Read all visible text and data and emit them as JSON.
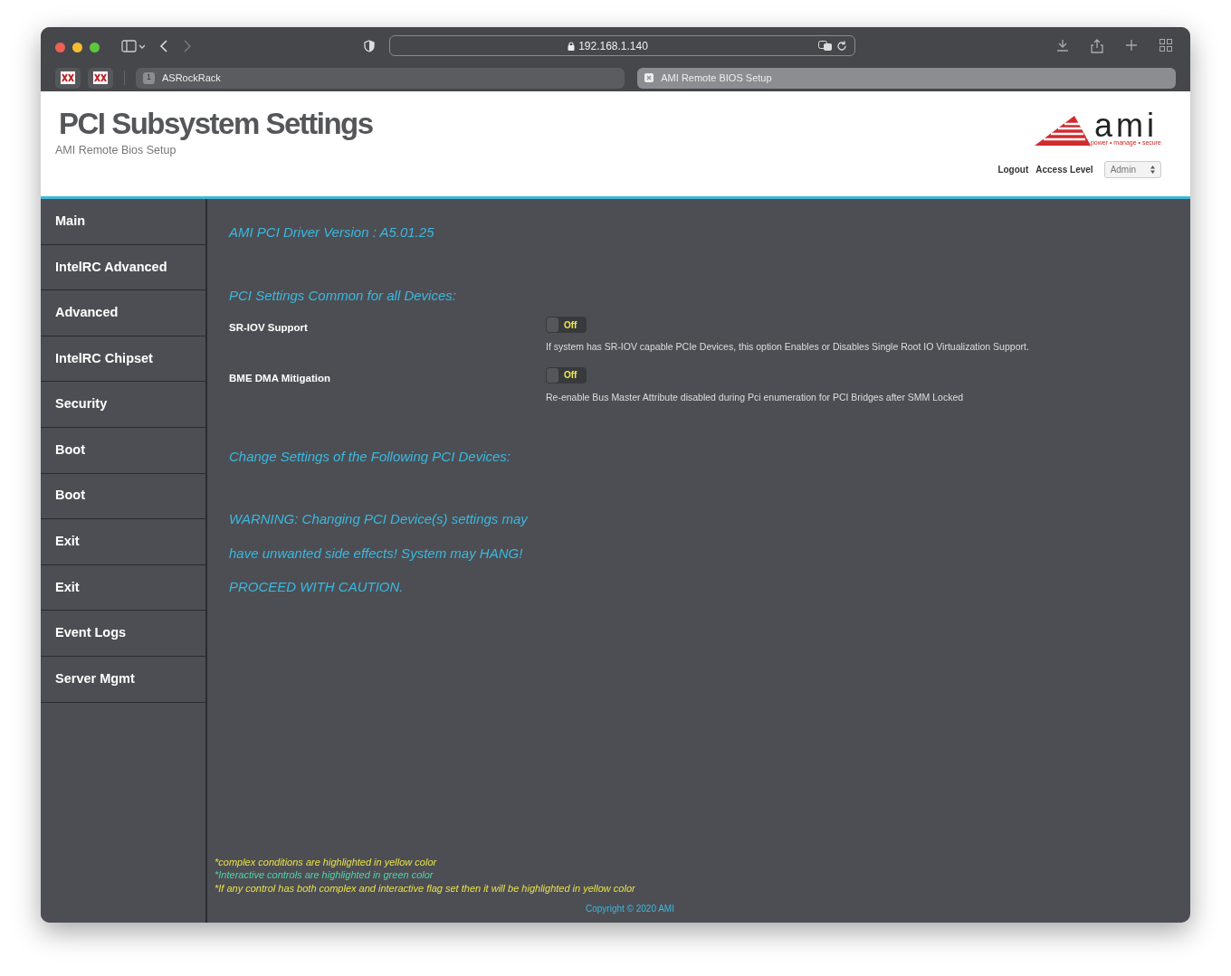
{
  "browser": {
    "url": "192.168.1.140",
    "tabs": [
      {
        "label": "ASRockRack",
        "badge": "1",
        "selected": false
      },
      {
        "label": "AMI Remote BIOS Setup",
        "selected": true
      }
    ]
  },
  "header": {
    "title": "PCI Subsystem Settings",
    "subtitle": "AMI Remote Bios Setup",
    "logo_text": "ami",
    "logo_tagline": "power • manage • secure",
    "logout": "Logout",
    "access_level_label": "Access Level",
    "access_level_value": "Admin"
  },
  "sidebar": {
    "items": [
      {
        "label": "Main"
      },
      {
        "label": "IntelRC Advanced"
      },
      {
        "label": "Advanced"
      },
      {
        "label": "IntelRC Chipset"
      },
      {
        "label": "Security"
      },
      {
        "label": "Boot"
      },
      {
        "label": "Boot"
      },
      {
        "label": "Exit"
      },
      {
        "label": "Exit"
      },
      {
        "label": "Event Logs"
      },
      {
        "label": "Server Mgmt"
      }
    ]
  },
  "content": {
    "driver_version": "AMI PCI Driver Version : A5.01.25",
    "common_heading": "PCI Settings Common for all Devices:",
    "settings": [
      {
        "label": "SR-IOV Support",
        "value": "Off",
        "on": false,
        "help": "If system has SR-IOV capable PCIe Devices, this option Enables or Disables Single Root IO Virtualization Support."
      },
      {
        "label": "BME DMA Mitigation",
        "value": "Off",
        "on": false,
        "help": "Re-enable Bus Master Attribute disabled during Pci enumeration for PCI Bridges after SMM Locked"
      }
    ],
    "devices_heading": "Change Settings of the Following PCI Devices:",
    "warning_lines": [
      "WARNING: Changing PCI Device(s) settings may",
      "have unwanted side effects! System may HANG!",
      "PROCEED WITH CAUTION."
    ]
  },
  "footer": {
    "notes": [
      {
        "text": "*complex conditions are highlighted in yellow color",
        "color": "#e6e04a"
      },
      {
        "text": "*Interactive controls are highlighted in green color",
        "color": "#4fd3a8"
      },
      {
        "text": "*If any control has both complex and interactive flag set then it will be highlighted in yellow color",
        "color": "#e6e04a"
      }
    ],
    "copyright": "Copyright © 2020 AMI"
  }
}
